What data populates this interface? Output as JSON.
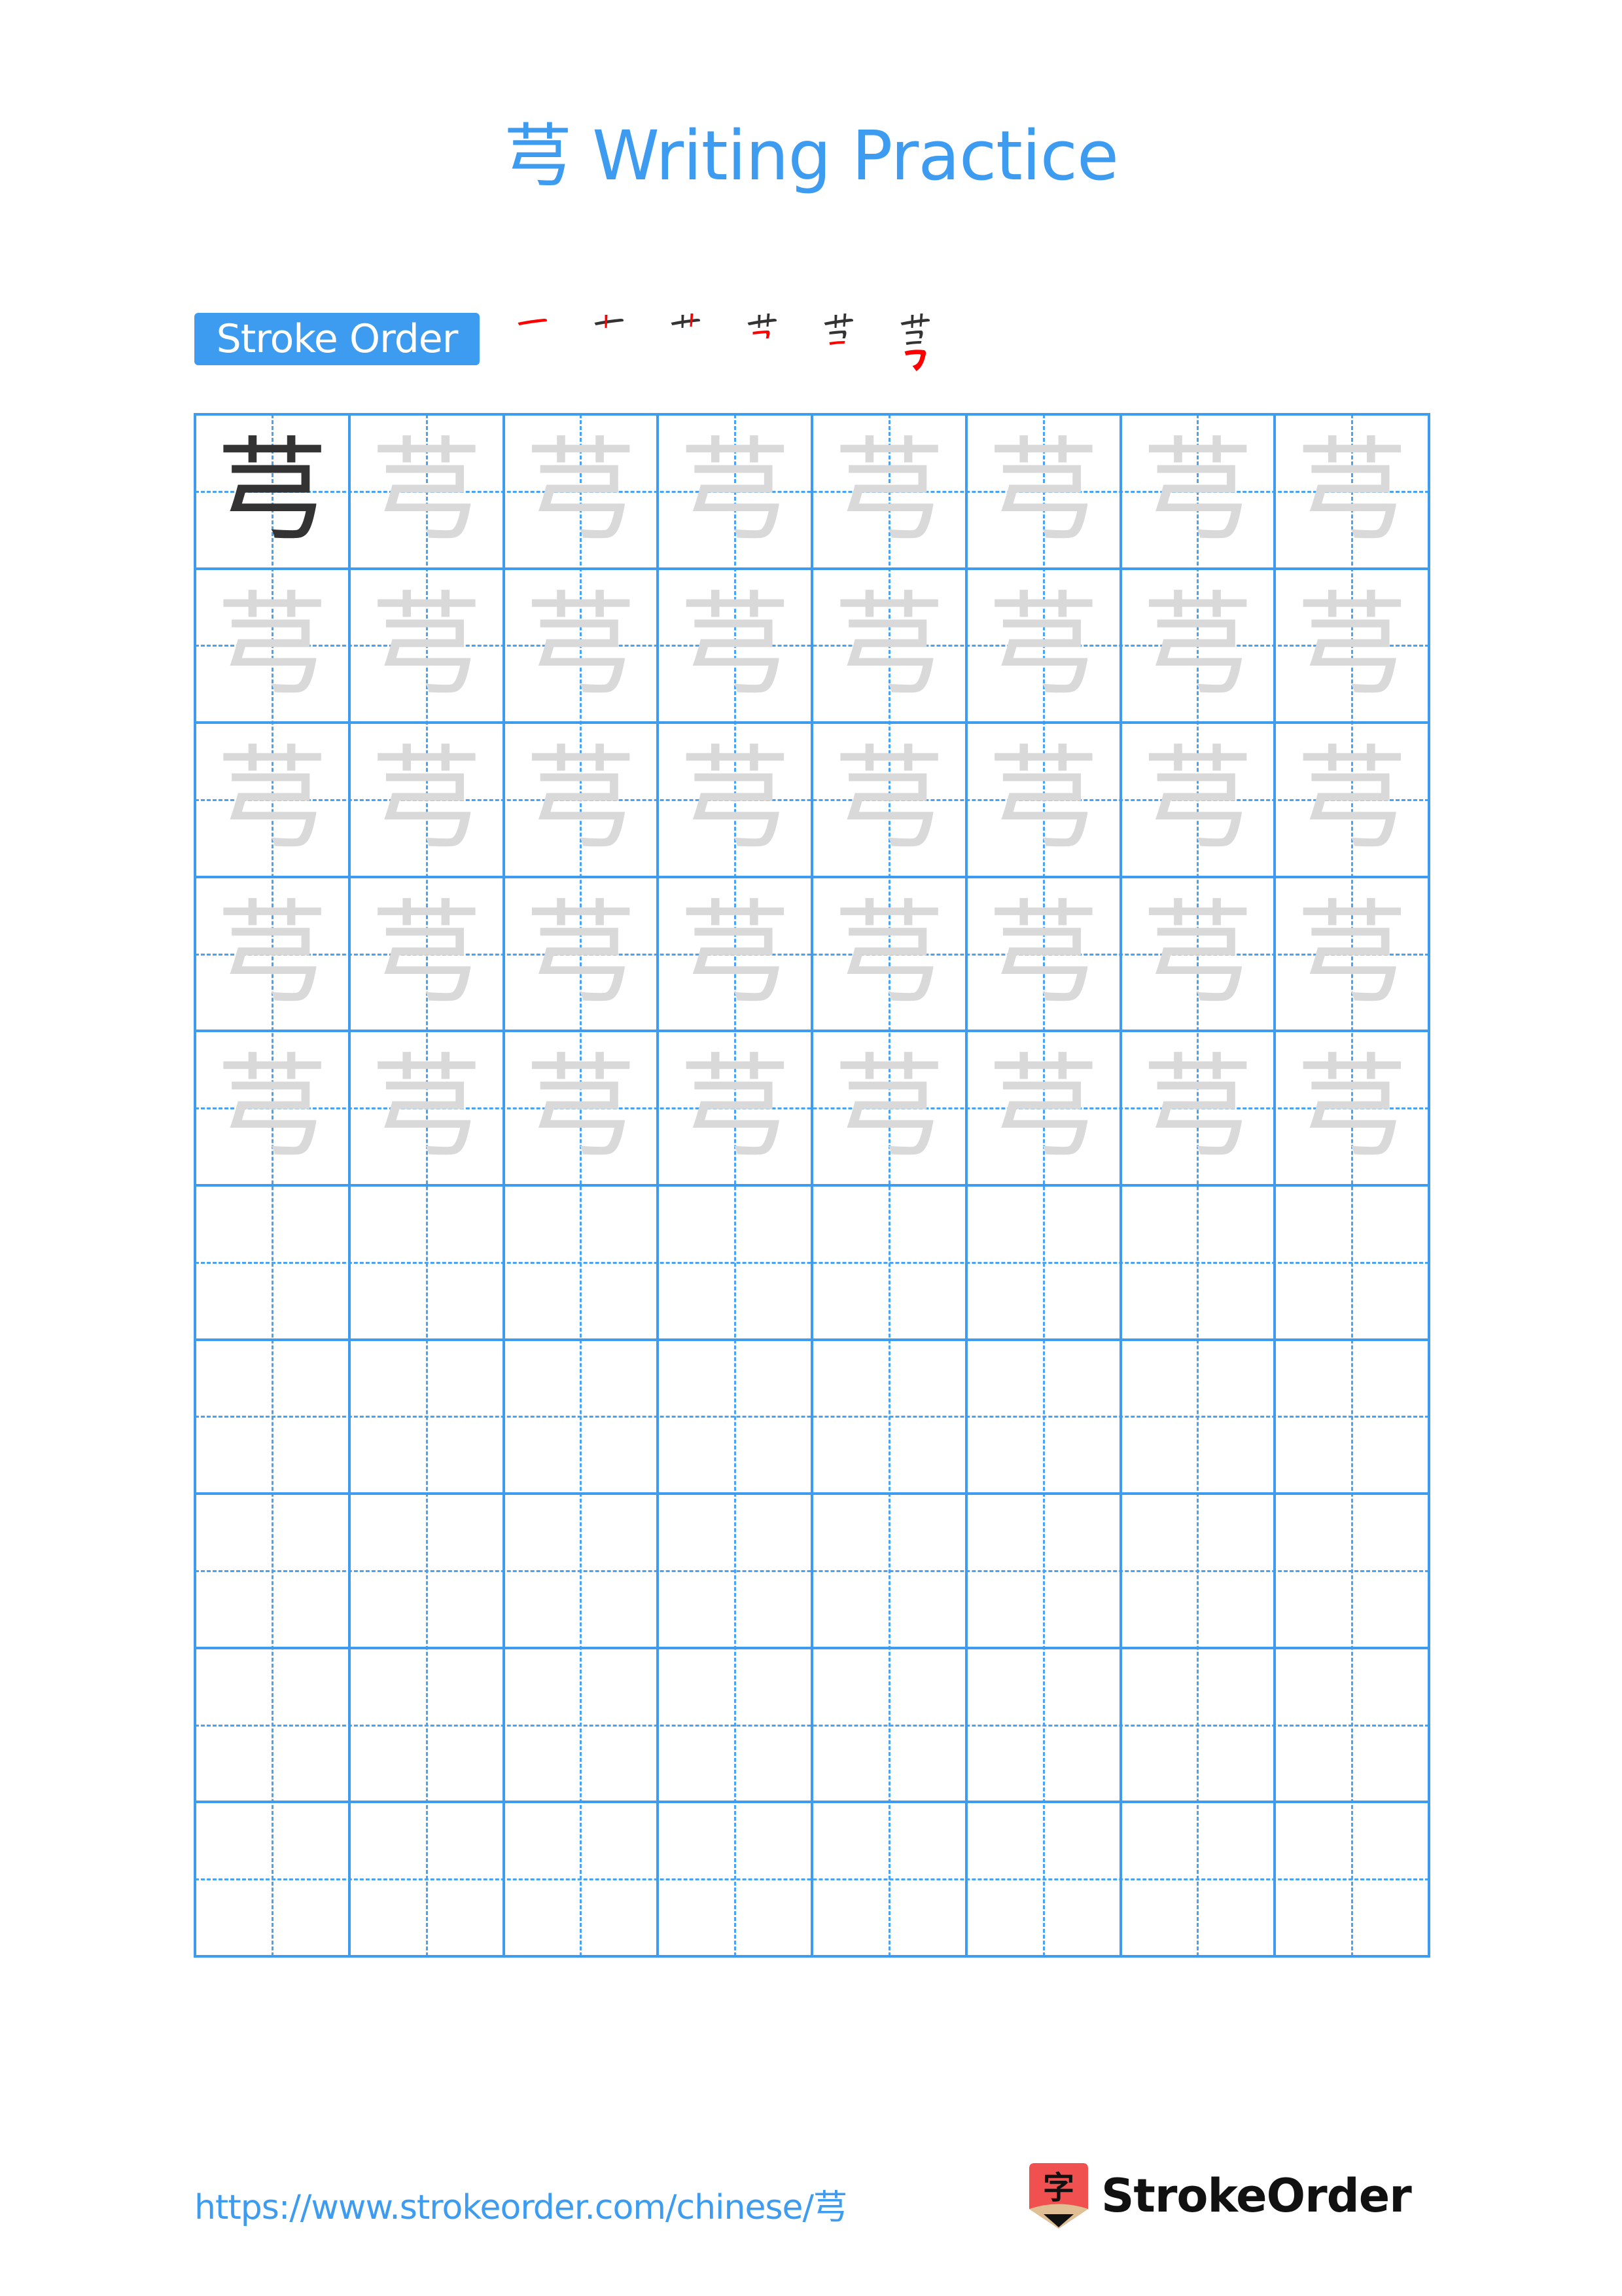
{
  "header": {
    "title": "芎 Writing Practice"
  },
  "stroke_order": {
    "label": "Stroke Order",
    "character": "芎",
    "steps": 6,
    "highlight_color": "#ff0000",
    "done_color": "#333333"
  },
  "grid": {
    "rows": 10,
    "columns": 8,
    "character": "芎",
    "model_cells": 1,
    "trace_rows": 5,
    "line_color": "#3d9bf0",
    "model_color": "#333333",
    "trace_color": "#d9d9d9"
  },
  "footer": {
    "url": "https://www.strokeorder.com/chinese/芎",
    "brand": "StrokeOrder",
    "logo_glyph": "字"
  }
}
